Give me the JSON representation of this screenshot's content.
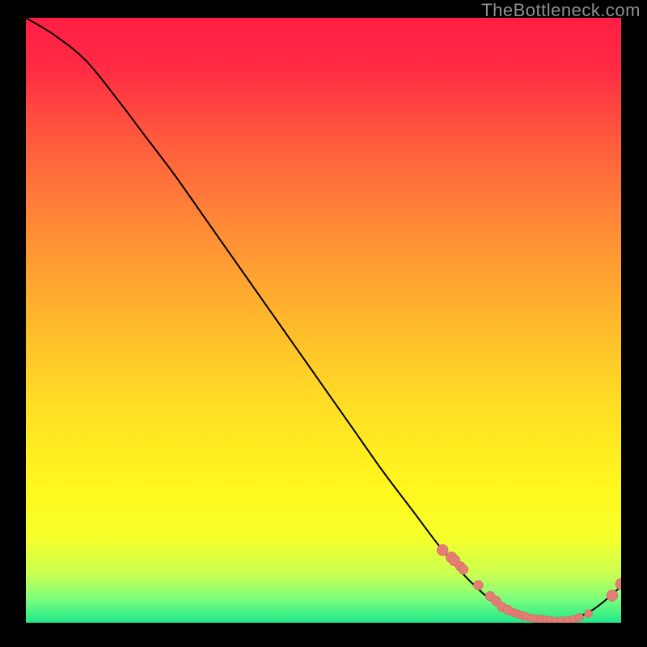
{
  "watermark": "TheBottleneck.com",
  "colors": {
    "curve_stroke": "#000000",
    "point_fill": "#e37d75",
    "point_stroke": "#c96058",
    "gradient_top": "#ff1f44",
    "gradient_mid": "#ffe024",
    "gradient_bottom": "#20e88a"
  },
  "chart_data": {
    "type": "line",
    "title": "",
    "xlabel": "",
    "ylabel": "",
    "xlim": [
      0,
      100
    ],
    "ylim": [
      0,
      100
    ],
    "x": [
      0,
      5,
      10,
      15,
      20,
      25,
      30,
      35,
      40,
      45,
      50,
      55,
      60,
      65,
      70,
      75,
      80,
      85,
      90,
      95,
      100
    ],
    "y": [
      100,
      97,
      93,
      87,
      80.5,
      74,
      67,
      60,
      53,
      46,
      39,
      32,
      25,
      18.5,
      12,
      6.5,
      2.5,
      0.6,
      0.3,
      2,
      6
    ],
    "scatter_x": [
      70,
      71.5,
      72,
      73,
      73.5,
      76,
      78,
      79,
      80,
      81,
      82,
      82.5,
      83,
      83.5,
      84,
      85,
      86,
      86.5,
      87,
      87.5,
      88,
      89,
      90,
      91,
      92,
      93,
      94.5,
      98.5,
      100
    ],
    "scatter_y": [
      12,
      10.8,
      10.3,
      9.3,
      8.8,
      6.2,
      4.4,
      3.6,
      2.6,
      2.1,
      1.65,
      1.5,
      1.3,
      1.15,
      1.0,
      0.8,
      0.65,
      0.6,
      0.5,
      0.45,
      0.4,
      0.3,
      0.3,
      0.4,
      0.55,
      0.9,
      1.5,
      4.5,
      6.4
    ],
    "scatter_r": [
      7,
      7,
      7,
      6,
      6,
      6,
      6,
      6,
      6,
      6,
      5,
      5,
      5,
      5,
      5,
      5,
      5,
      5,
      5,
      5,
      5,
      5,
      5,
      5,
      5,
      5,
      5,
      7,
      7
    ]
  }
}
